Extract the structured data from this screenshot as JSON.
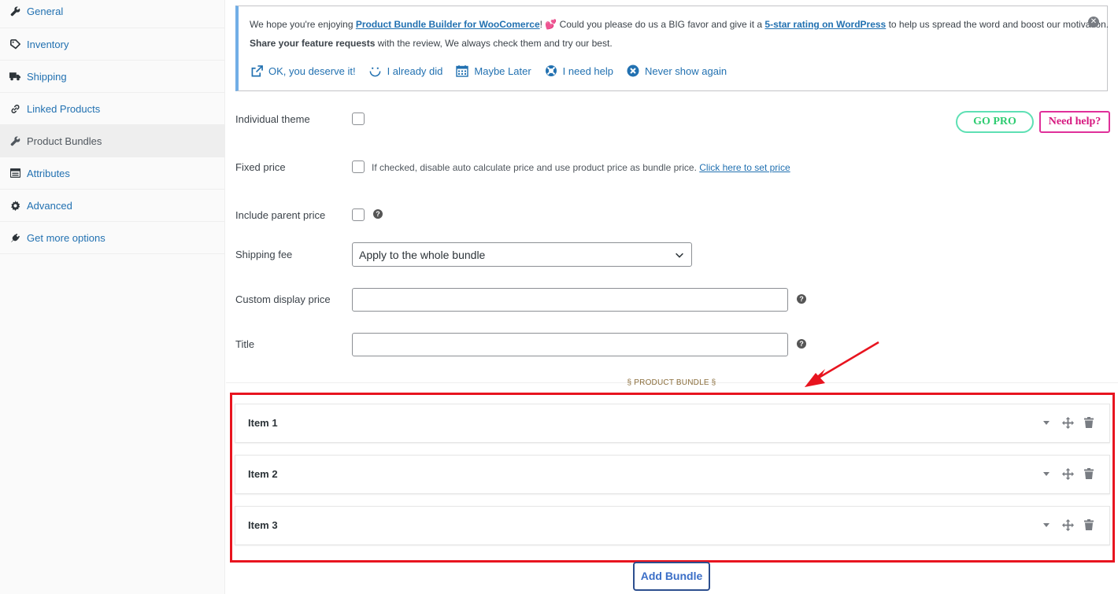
{
  "sidebar": {
    "items": [
      {
        "label": "General",
        "icon": "wrench-icon"
      },
      {
        "label": "Inventory",
        "icon": "tag-icon"
      },
      {
        "label": "Shipping",
        "icon": "truck-icon"
      },
      {
        "label": "Linked Products",
        "icon": "link-icon"
      },
      {
        "label": "Product Bundles",
        "icon": "wrench-icon",
        "active": true
      },
      {
        "label": "Attributes",
        "icon": "list-icon"
      },
      {
        "label": "Advanced",
        "icon": "gear-icon"
      },
      {
        "label": "Get more options",
        "icon": "plug-icon"
      }
    ]
  },
  "notice": {
    "text_before": "We hope you're enjoying ",
    "plugin_link": "Product Bundle Builder for WooComerce",
    "text_middle": "! 💕 Could you please do us a BIG favor and give it a ",
    "rating_link": "5-star rating on WordPress",
    "text_after": " to help us spread the word and boost our motivation.",
    "line2_bold": "Share your feature requests",
    "line2_rest": " with the review, We always check them and try our best.",
    "actions": [
      {
        "label": "OK, you deserve it!",
        "icon": "external-link-icon"
      },
      {
        "label": "I already did",
        "icon": "smile-icon"
      },
      {
        "label": "Maybe Later",
        "icon": "calendar-icon"
      },
      {
        "label": "I need help",
        "icon": "lifebuoy-icon"
      },
      {
        "label": "Never show again",
        "icon": "close-circle-icon"
      }
    ]
  },
  "buttons": {
    "go_pro": "GO PRO",
    "need_help": "Need help?",
    "add_bundle": "Add Bundle"
  },
  "form": {
    "individual_theme_label": "Individual theme",
    "fixed_price_label": "Fixed price",
    "fixed_price_desc": "If checked, disable auto calculate price and use product price as bundle price. ",
    "fixed_price_link": "Click here to set price",
    "include_parent_price_label": "Include parent price",
    "shipping_fee_label": "Shipping fee",
    "shipping_fee_value": "Apply to the whole bundle",
    "custom_display_price_label": "Custom display price",
    "custom_display_price_value": "",
    "title_label": "Title",
    "title_value": "",
    "help_glyph": "?"
  },
  "bundle": {
    "heading": "§ PRODUCT BUNDLE §",
    "items": [
      "Item 1",
      "Item 2",
      "Item 3"
    ]
  },
  "colors": {
    "link": "#2271b1",
    "highlight_border": "#e8141f",
    "go_pro": "#2ecc71",
    "need_help": "#d6177f",
    "notice_accent": "#72aee6"
  }
}
